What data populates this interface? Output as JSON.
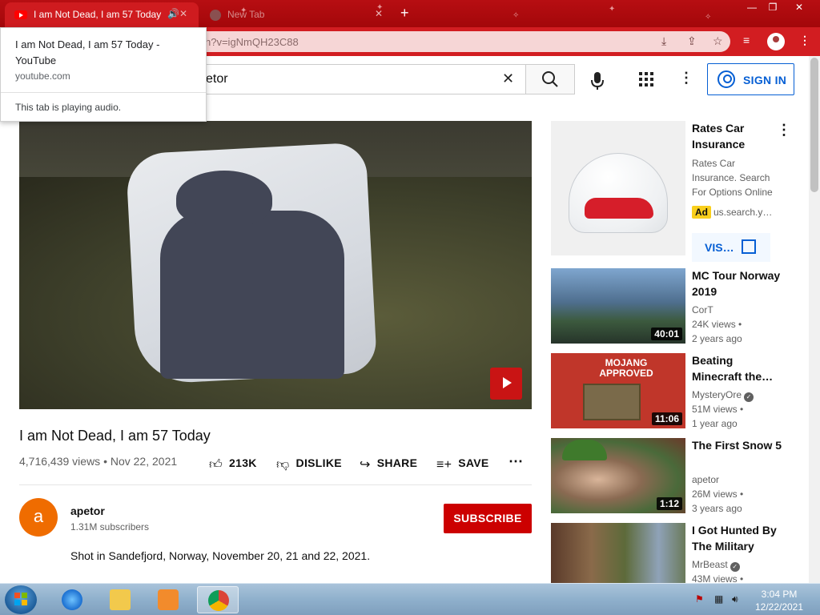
{
  "browser": {
    "active_tab_title": "I am Not Dead, I am 57 Today - YouTube",
    "inactive_tab_title": "New Tab",
    "url": "youtube.com/watch?v=igNmQH23C88",
    "url_visible": "h?v=igNmQH23C88"
  },
  "hover_card": {
    "title": "I am Not Dead, I am 57 Today - YouTube",
    "domain": "youtube.com",
    "audio_status": "This tab is playing audio."
  },
  "youtube": {
    "search_query": "apetor",
    "search_query_visible": "etor",
    "sign_in_label": "SIGN IN"
  },
  "video": {
    "title": "I am Not Dead, I am 57 Today",
    "meta": "4,716,439 views • Nov 22, 2021",
    "like_count": "213K",
    "dislike_label": "DISLIKE",
    "share_label": "SHARE",
    "save_label": "SAVE"
  },
  "channel": {
    "avatar_letter": "a",
    "name": "apetor",
    "subscribers": "1.31M subscribers",
    "subscribe_label": "SUBSCRIBE",
    "description": "Shot in Sandefjord, Norway, November 20, 21 and 22, 2021."
  },
  "ad": {
    "title": "Rates Car Insurance",
    "description": "Rates Car Insurance. Search For Options Online",
    "badge": "Ad",
    "domain": "us.search.y…",
    "visit_label": "VIS…"
  },
  "recommendations": [
    {
      "title": "MC Tour Norway 2019",
      "channel": "CorT",
      "views": "24K views •",
      "age": "2 years ago",
      "duration": "40:01",
      "verified": false
    },
    {
      "title": "Beating Minecraft the…",
      "channel": "MysteryOre",
      "views": "51M views •",
      "age": "1 year ago",
      "duration": "11:06",
      "verified": true,
      "thumb_text": "MOJANG APPROVED"
    },
    {
      "title": "The First Snow 5",
      "channel": "apetor",
      "views": "26M views •",
      "age": "3 years ago",
      "duration": "1:12",
      "verified": false
    },
    {
      "title": "I Got Hunted By The Military",
      "channel": "MrBeast",
      "views": "43M views •",
      "age": "",
      "duration": "",
      "verified": true
    }
  ],
  "taskbar": {
    "time": "3:04 PM",
    "date": "12/22/2021"
  },
  "colors": {
    "chrome_red": "#d21d21",
    "youtube_red": "#cc0000",
    "link_blue": "#065fd4",
    "ad_yellow": "#f9cf1c"
  }
}
